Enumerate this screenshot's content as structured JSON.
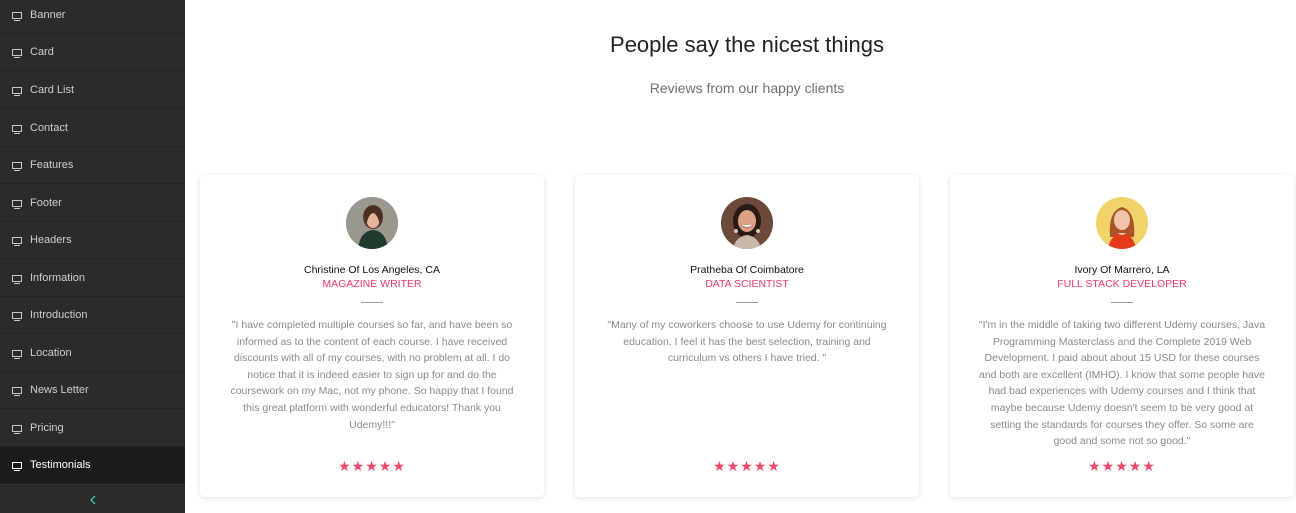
{
  "sidebar": {
    "items": [
      {
        "label": "Banner",
        "icon": "monitor-icon"
      },
      {
        "label": "Card",
        "icon": "monitor-icon"
      },
      {
        "label": "Card List",
        "icon": "monitor-icon"
      },
      {
        "label": "Contact",
        "icon": "monitor-icon"
      },
      {
        "label": "Features",
        "icon": "monitor-icon"
      },
      {
        "label": "Footer",
        "icon": "monitor-icon"
      },
      {
        "label": "Headers",
        "icon": "monitor-icon"
      },
      {
        "label": "Information",
        "icon": "monitor-icon"
      },
      {
        "label": "Introduction",
        "icon": "monitor-icon"
      },
      {
        "label": "Location",
        "icon": "monitor-icon"
      },
      {
        "label": "News Letter",
        "icon": "monitor-icon"
      },
      {
        "label": "Pricing",
        "icon": "monitor-icon"
      },
      {
        "label": "Testimonials",
        "icon": "monitor-icon",
        "active": true
      }
    ],
    "collapse_icon": "chevron-left-icon",
    "accent_color": "#38c9b5",
    "background": "#2b2b2b"
  },
  "section": {
    "title": "People say the nicest things",
    "subtitle": "Reviews from our happy clients"
  },
  "testimonials": [
    {
      "name": "Christine Of Los Angeles, CA",
      "role": "MAGAZINE WRITER",
      "quote": "\"I have completed multiple courses so far, and have been so informed as to the content of each course. I have received discounts with all of my courses, with no problem at all. I do notice that it is indeed easier to sign up for and do the coursework on my Mac, not my phone. So happy that I found this great platform with wonderful educators! Thank you Udemy!!!\"",
      "stars": "★★★★★",
      "rating": 5
    },
    {
      "name": "Pratheba Of Coimbatore",
      "role": "DATA SCIENTIST",
      "quote": "\"Many of my coworkers choose to use Udemy for continuing education. I feel it has the best selection, training and curriculum vs others I have tried. \"",
      "stars": "★★★★★",
      "rating": 5
    },
    {
      "name": "Ivory Of Marrero, LA",
      "role": "FULL STACK DEVELOPER",
      "quote": "\"I'm in the middle of taking two different Udemy courses, Java Programming Masterclass and the Complete 2019 Web Development. I paid about about 15 USD for these courses and both are excellent (IMHO). I know that some people have had bad experiences with Udemy courses and I think that maybe because Udemy doesn't seem to be very good at setting the standards for courses they offer. So some are good and some not so good.\"",
      "stars": "★★★★★",
      "rating": 5
    }
  ],
  "colors": {
    "role": "#ee3a6a",
    "star": "#ef4868"
  }
}
